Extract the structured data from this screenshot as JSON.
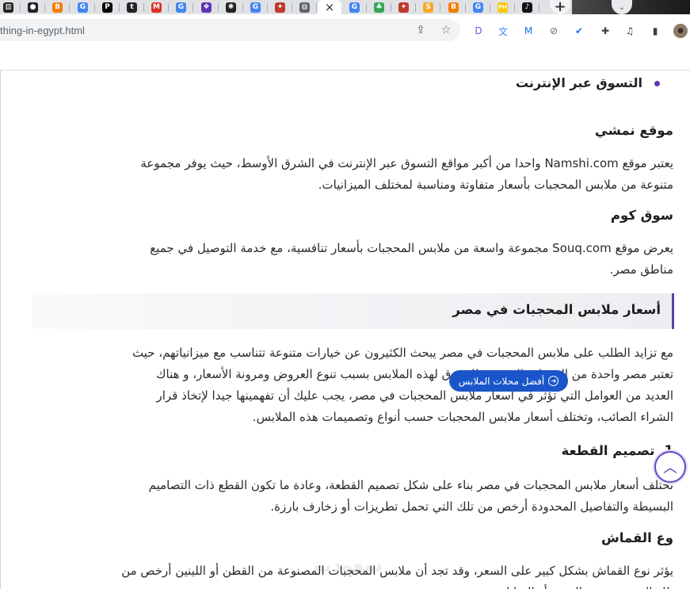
{
  "browser": {
    "tabs": [
      {
        "icon": "bars-icon",
        "color": "#222222",
        "glyph": "▥"
      },
      {
        "icon": "dots-icon",
        "color": "#222222",
        "glyph": "●"
      },
      {
        "icon": "blogger-icon",
        "color": "#f57c00",
        "glyph": "B"
      },
      {
        "icon": "google-icon",
        "color": "#4285f4",
        "glyph": "G"
      },
      {
        "icon": "p-icon",
        "color": "#000000",
        "glyph": "P"
      },
      {
        "icon": "tumblr-icon",
        "color": "#222222",
        "glyph": "t"
      },
      {
        "icon": "gmail-icon",
        "color": "#d93025",
        "glyph": "M"
      },
      {
        "icon": "google-icon",
        "color": "#4285f4",
        "glyph": "G"
      },
      {
        "icon": "puzzle-app-icon",
        "color": "#5e35b1",
        "glyph": "❖"
      },
      {
        "icon": "openai-icon",
        "color": "#222222",
        "glyph": "✺"
      },
      {
        "icon": "google-icon",
        "color": "#4285f4",
        "glyph": "G"
      },
      {
        "icon": "crest-icon",
        "color": "#c0392b",
        "glyph": "✦"
      },
      {
        "icon": "globe-icon",
        "color": "#5f6368",
        "glyph": "◍"
      },
      {
        "icon": "close-icon",
        "color": "#333333",
        "glyph": "×",
        "active": true
      },
      {
        "icon": "google-icon",
        "color": "#4285f4",
        "glyph": "G"
      },
      {
        "icon": "tree-icon",
        "color": "#34a853",
        "glyph": "♣"
      },
      {
        "icon": "crest-icon",
        "color": "#c0392b",
        "glyph": "✦"
      },
      {
        "icon": "s-icon",
        "color": "#f9a825",
        "glyph": "S"
      },
      {
        "icon": "blogger-icon",
        "color": "#f57c00",
        "glyph": "B"
      },
      {
        "icon": "google-icon",
        "color": "#4285f4",
        "glyph": "G"
      },
      {
        "icon": "ph-icon",
        "color": "#f9c600",
        "glyph": "PH"
      },
      {
        "icon": "tiktok-icon",
        "color": "#111111",
        "glyph": "♪"
      }
    ],
    "new_tab_glyph": "+",
    "tab_search_glyph": "⌄",
    "url": "thing-in-egypt.html",
    "omnibox_icons": [
      "share-icon",
      "star-icon"
    ],
    "extensions": [
      {
        "name": "d-extension-icon",
        "glyph": "D",
        "color": "#5b5fe8"
      },
      {
        "name": "translate-extension-icon",
        "glyph": "文",
        "color": "#4285f4"
      },
      {
        "name": "m-extension-icon",
        "glyph": "M",
        "color": "#1a73e8"
      },
      {
        "name": "block-extension-icon",
        "glyph": "⊘",
        "color": "#5f6368"
      },
      {
        "name": "check-extension-icon",
        "glyph": "✔",
        "color": "#1a73e8"
      },
      {
        "name": "puzzle-extensions-icon",
        "glyph": "✚",
        "color": "#3c4043"
      },
      {
        "name": "media-control-icon",
        "glyph": "♫",
        "color": "#3c4043"
      },
      {
        "name": "side-panel-icon",
        "glyph": "▮",
        "color": "#3c4043"
      },
      {
        "name": "profile-avatar-icon",
        "glyph": "●",
        "color": "#6d5d4b"
      }
    ]
  },
  "article": {
    "bullet_item": "التسوق عبر الإنترنت",
    "namshi_heading": "موقع نمشي",
    "namshi_line1": "يعتبر موقع Namshi.com واحدا من أكبر مواقع التسوق عبر الإنترنت في الشرق الأوسط، حيث يوفر مجموعة",
    "namshi_line2": "متنوعة من ملابس المحجبات بأسعار متفاوتة ومناسبة لمختلف الميزانيات.",
    "souq_heading": "سوق كوم",
    "souq_line1": "يعرض موقع Souq.com مجموعة واسعة من ملابس المحجبات بأسعار تنافسية، مع خدمة التوصيل في جميع",
    "souq_line2": "مناطق مصر.",
    "prices_heading": "أسعار ملابس المحجبات في مصر",
    "prices_line1": "مع تزايد الطلب على ملابس المحجبات في مصر يبحث الكثيرون عن خيارات متنوعة تتناسب مع ميزانياتهم، حيث",
    "prices_line2": "تعتبر مصر واحدة من الوجهات الرئيسية للتسوق لهذه الملابس بسبب تنوع العروض ومرونة الأسعار، و هناك",
    "prices_line3": "العديد من العوامل التي تؤثر في أسعار ملابس المحجبات في مصر، يجب عليك أن تفهمينها جيدا لإتخاذ قرار",
    "prices_line4": "الشراء الصائب، وتختلف أسعار ملابس المحجبات حسب أنواع وتصميمات هذه الملابس.",
    "design_heading": "1. تصميم القطعة",
    "pill_label": "أفضل محلات الملابس",
    "design_line1": "تختلف أسعار ملابس المحجبات في مصر بناء على شكل تصميم القطعة، وعادة ما تكون القطع ذات التصاميم",
    "design_line2": "البسيطة والتفاصيل المحدودة أرخص من تلك التي تحمل تطريزات أو زخارف بارزة.",
    "fabric_heading": "وع القماش",
    "fabric_line1": "يؤثر نوع القماش بشكل كبير على السعر، وقد تجد أن ملابس المحجبات المصنوعة من القطن أو اللينين أرخص من",
    "fabric_line2": "تلك المصنوعة من الحرير أو الساتان.",
    "scroll_top_glyph": "︿",
    "watermark": "سعودية"
  },
  "colors": {
    "accent": "#5c3fb0",
    "pill": "#1a56c9"
  }
}
